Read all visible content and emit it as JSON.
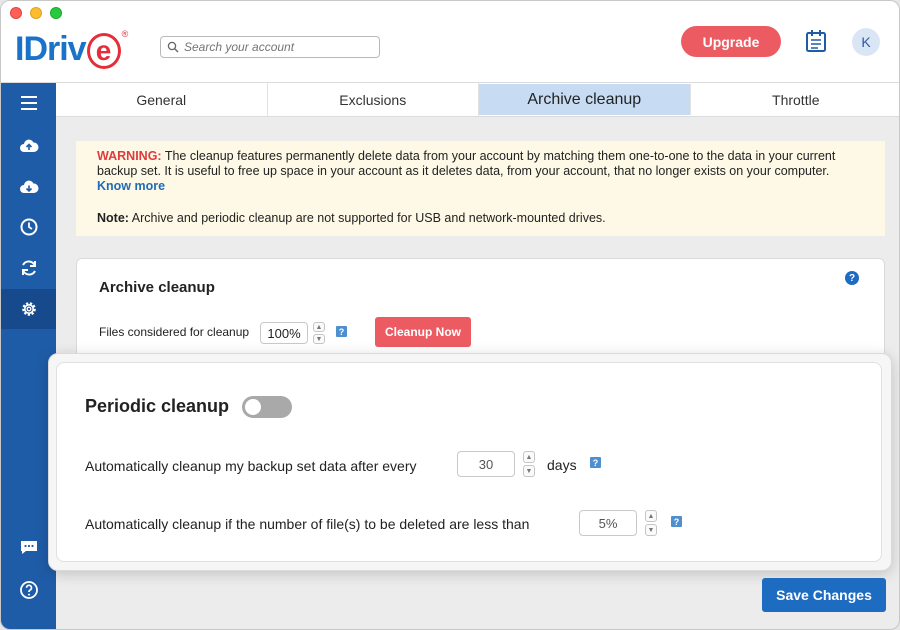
{
  "header": {
    "logo_text": "IDriv",
    "logo_e": "e",
    "logo_reg": "®",
    "search_placeholder": "Search your account",
    "upgrade_label": "Upgrade",
    "avatar_initial": "K"
  },
  "sidebar": {
    "items": [
      {
        "icon": "menu-icon"
      },
      {
        "icon": "cloud-upload-icon"
      },
      {
        "icon": "cloud-download-icon"
      },
      {
        "icon": "schedule-icon"
      },
      {
        "icon": "sync-icon"
      },
      {
        "icon": "gear-icon",
        "active": true
      },
      {
        "icon": "chat-icon"
      },
      {
        "icon": "help-icon"
      }
    ]
  },
  "tabs": [
    "General",
    "Exclusions",
    "Archive cleanup",
    "Throttle"
  ],
  "warning": {
    "label": "WARNING:",
    "text": " The cleanup features permanently delete data from your account by matching them one-to-one to the data in your current backup set. It is useful to free up space in your account as it deletes data, from your account, that no longer exists on your computer.",
    "link": "Know more",
    "note_label": "Note:",
    "note_text": " Archive and periodic cleanup are not supported for USB and network-mounted drives."
  },
  "archive": {
    "title": "Archive cleanup",
    "help": "?",
    "files_label": "Files considered for cleanup",
    "percent": "100%",
    "cleanup_button": "Cleanup Now"
  },
  "periodic": {
    "title": "Periodic cleanup",
    "toggle_on": false,
    "row1_label": "Automatically cleanup my backup set data after every",
    "row1_value": "30",
    "row1_unit": "days",
    "row2_label": "Automatically cleanup if the number of file(s) to be deleted are less than",
    "row2_value": "5%"
  },
  "save_label": "Save Changes",
  "colors": {
    "brand_blue": "#1f5ca8",
    "accent_red": "#ec5b62",
    "active_tab": "#c7dcf3"
  }
}
